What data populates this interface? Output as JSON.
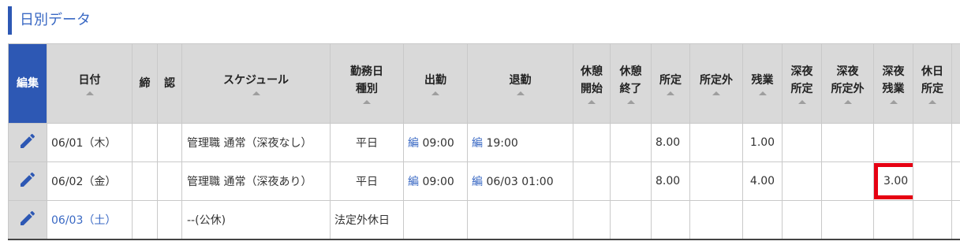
{
  "section": {
    "title": "日別データ"
  },
  "headers": {
    "edit": "編集",
    "date": "日付",
    "close": "締",
    "approve": "認",
    "schedule": "スケジュール",
    "day_type_1": "勤務日",
    "day_type_2": "種別",
    "clock_in": "出勤",
    "clock_out": "退勤",
    "break_start_1": "休憩",
    "break_start_2": "開始",
    "break_end_1": "休憩",
    "break_end_2": "終了",
    "scheduled": "所定",
    "non_scheduled": "所定外",
    "overtime": "残業",
    "night_scheduled_1": "深夜",
    "night_scheduled_2": "所定",
    "night_non_scheduled_1": "深夜",
    "night_non_scheduled_2": "所定外",
    "night_overtime_1": "深夜",
    "night_overtime_2": "残業",
    "holiday_scheduled_1": "休日",
    "holiday_scheduled_2": "所定"
  },
  "rows": [
    {
      "date": "06/01（木）",
      "schedule": "管理職 通常（深夜なし）",
      "day_type": "平日",
      "clock_in_edit": "編",
      "clock_in": "09:00",
      "clock_out_edit": "編",
      "clock_out": "19:00",
      "scheduled": "8.00",
      "overtime": "1.00",
      "night_overtime": ""
    },
    {
      "date": "06/02（金）",
      "schedule": "管理職 通常（深夜あり）",
      "day_type": "平日",
      "clock_in_edit": "編",
      "clock_in": "09:00",
      "clock_out_edit": "編",
      "clock_out": "06/03 01:00",
      "scheduled": "8.00",
      "overtime": "4.00",
      "night_overtime": "3.00"
    },
    {
      "date": "06/03（土）",
      "schedule": "--(公休)",
      "day_type": "法定外休日"
    }
  ],
  "colors": {
    "accent": "#2d58b4",
    "link": "#3a69c4",
    "highlight": "#e60012",
    "header_bg": "#d9d9d9"
  },
  "icons": {
    "edit_row": "pencil-icon"
  }
}
